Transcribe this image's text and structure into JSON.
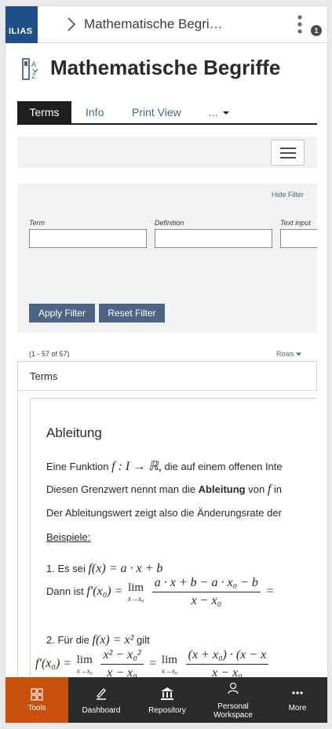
{
  "header": {
    "logo_text": "ILIAS",
    "breadcrumb": "Mathematische Begri…",
    "notification_count": "1"
  },
  "page": {
    "title": "Mathematische Begriffe",
    "icon": "glossary-icon"
  },
  "tabs": [
    {
      "label": "Terms",
      "active": true
    },
    {
      "label": "Info",
      "active": false
    },
    {
      "label": "Print View",
      "active": false
    },
    {
      "label": "...",
      "active": false
    }
  ],
  "filter": {
    "hide_label": "Hide Filter",
    "fields": [
      {
        "label": "Term",
        "value": ""
      },
      {
        "label": "Definition",
        "value": ""
      },
      {
        "label": "Text input",
        "value": ""
      }
    ],
    "apply_label": "Apply Filter",
    "reset_label": "Reset Filter"
  },
  "results": {
    "count": "(1 - 57 of 57)",
    "rows_label": "Rows",
    "column_header": "Terms"
  },
  "entry": {
    "term": "Ableitung",
    "line1_a": "Eine Funktion",
    "line1_math": "f : I → ℝ,",
    "line1_b": "die auf einem offenen Inte",
    "line2_a": "Diesen Grenzwert nennt man die",
    "line2_bold": "Ableitung",
    "line2_b": "von",
    "line2_math": "f",
    "line2_c": "in",
    "line3": "Der Ableitungswert zeigt also die Änderungsrate der",
    "examples_label": "Beispiele:",
    "ex1_a": "1. Es sei",
    "ex1_math": "f(x) = a · x + b",
    "ex1_b": "Dann ist",
    "ex1_lhs": "f′(x₀) =",
    "ex1_lim": "lim",
    "ex1_limsub": "x→x₀",
    "ex1_num": "a · x + b − a · x₀ − b",
    "ex1_den": "x − x₀",
    "ex1_eq": "=",
    "ex2_a": "2. Für die",
    "ex2_math": "f(x) = x²",
    "ex2_b": "gilt",
    "ex2_lhs": "f′(x₀) =",
    "ex2_lim1": "lim",
    "ex2_limsub1": "x→x₀",
    "ex2_num1": "x² − x₀²",
    "ex2_den1": "x − x₀",
    "ex2_eq": "=",
    "ex2_lim2": "lim",
    "ex2_limsub2": "x→x₀",
    "ex2_num2": "(x + x₀) · (x − x",
    "ex2_den2": "x − x₀"
  },
  "bottom_nav": [
    {
      "label": "Tools",
      "icon": "grid-icon",
      "active": true
    },
    {
      "label": "Dashboard",
      "icon": "dashboard-icon",
      "active": false
    },
    {
      "label": "Repository",
      "icon": "repository-icon",
      "active": false
    },
    {
      "label": "Personal Workspace",
      "icon": "person-icon",
      "active": false
    },
    {
      "label": "More",
      "icon": "more-icon",
      "active": false
    }
  ],
  "colors": {
    "logo": "#1e4f86",
    "link": "#4c6586",
    "active_nav": "#c8500c",
    "nav_bg": "#2b2b2b"
  }
}
